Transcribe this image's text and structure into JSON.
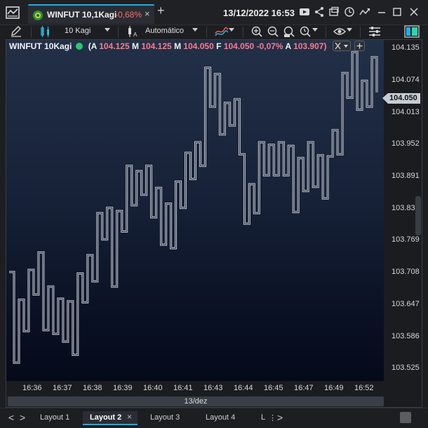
{
  "titlebar": {
    "tab_title": "WINFUT 10,1Kagi",
    "tab_change": "-0,68%",
    "close_glyph": "×",
    "new_tab_glyph": "+",
    "datetime": "13/12/2022 16:53"
  },
  "toolbar": {
    "period": "10 Kagi",
    "scale_mode": "Automático"
  },
  "legend": {
    "symbol": "WINFUT 10Kagi",
    "a_label": "(A",
    "a_value": "104.125",
    "m1_label": "M",
    "m1_value": "104.125",
    "m2_label": "M",
    "m2_value": "104.050",
    "f_label": "F",
    "f_value": "104.050",
    "change": "-0,07%",
    "a2_label": "A",
    "a2_value": "103.907)"
  },
  "chart_data": {
    "type": "line",
    "style": "kagi",
    "y_tick_labels": [
      "104.135",
      "104.074",
      "104.013",
      "103.952",
      "103.891",
      "103.83",
      "103.769",
      "103.708",
      "103.647",
      "103.586",
      "103.525"
    ],
    "x_tick_labels": [
      "16:36",
      "16:37",
      "16:38",
      "16:39",
      "16:40",
      "16:41",
      "16:43",
      "16:44",
      "16:45",
      "16:47",
      "16:49",
      "16:52"
    ],
    "date_label": "13/dez",
    "current_price": "104.050",
    "ylim": [
      103.5,
      104.15
    ],
    "line_color": "#c8ccd4",
    "kagi_path": [
      [
        0,
        103.708
      ],
      [
        1,
        103.708
      ],
      [
        1,
        103.535
      ],
      [
        2,
        103.535
      ],
      [
        2,
        103.655
      ],
      [
        3,
        103.655
      ],
      [
        3,
        103.595
      ],
      [
        4,
        103.595
      ],
      [
        4,
        103.712
      ],
      [
        5,
        103.712
      ],
      [
        5,
        103.665
      ],
      [
        6,
        103.665
      ],
      [
        6,
        103.745
      ],
      [
        7,
        103.745
      ],
      [
        7,
        103.597
      ],
      [
        8,
        103.597
      ],
      [
        8,
        103.68
      ],
      [
        9,
        103.68
      ],
      [
        9,
        103.59
      ],
      [
        10,
        103.59
      ],
      [
        10,
        103.657
      ],
      [
        11,
        103.657
      ],
      [
        11,
        103.575
      ],
      [
        12,
        103.575
      ],
      [
        12,
        103.652
      ],
      [
        13,
        103.652
      ],
      [
        13,
        103.55
      ],
      [
        14,
        103.55
      ],
      [
        14,
        103.705
      ],
      [
        15,
        103.705
      ],
      [
        15,
        103.65
      ],
      [
        16,
        103.65
      ],
      [
        16,
        103.74
      ],
      [
        17,
        103.74
      ],
      [
        17,
        103.69
      ],
      [
        18,
        103.69
      ],
      [
        18,
        103.82
      ],
      [
        19,
        103.82
      ],
      [
        19,
        103.77
      ],
      [
        20,
        103.77
      ],
      [
        20,
        103.83
      ],
      [
        21,
        103.83
      ],
      [
        21,
        103.68
      ],
      [
        22,
        103.68
      ],
      [
        22,
        103.824
      ],
      [
        23,
        103.824
      ],
      [
        23,
        103.785
      ],
      [
        24,
        103.785
      ],
      [
        24,
        103.91
      ],
      [
        25,
        103.91
      ],
      [
        25,
        103.835
      ],
      [
        26,
        103.835
      ],
      [
        26,
        103.9
      ],
      [
        27,
        103.9
      ],
      [
        27,
        103.855
      ],
      [
        28,
        103.855
      ],
      [
        28,
        103.91
      ],
      [
        29,
        103.91
      ],
      [
        29,
        103.812
      ],
      [
        30,
        103.812
      ],
      [
        30,
        103.868
      ],
      [
        31,
        103.868
      ],
      [
        31,
        103.76
      ],
      [
        32,
        103.76
      ],
      [
        32,
        103.838
      ],
      [
        33,
        103.838
      ],
      [
        33,
        103.753
      ],
      [
        34,
        103.753
      ],
      [
        34,
        103.88
      ],
      [
        35,
        103.88
      ],
      [
        35,
        103.83
      ],
      [
        36,
        103.83
      ],
      [
        36,
        103.935
      ],
      [
        37,
        103.935
      ],
      [
        37,
        103.885
      ],
      [
        38,
        103.885
      ],
      [
        38,
        103.955
      ],
      [
        39,
        103.955
      ],
      [
        39,
        103.91
      ],
      [
        40,
        103.91
      ],
      [
        40,
        104.097
      ],
      [
        41,
        104.097
      ],
      [
        41,
        104.023
      ],
      [
        42,
        104.023
      ],
      [
        42,
        104.085
      ],
      [
        43,
        104.085
      ],
      [
        43,
        103.97
      ],
      [
        44,
        103.97
      ],
      [
        44,
        104.03
      ],
      [
        45,
        104.03
      ],
      [
        45,
        103.987
      ],
      [
        46,
        103.987
      ],
      [
        46,
        104.037
      ],
      [
        47,
        104.037
      ],
      [
        47,
        103.932
      ],
      [
        48,
        103.932
      ],
      [
        48,
        103.8
      ],
      [
        49,
        103.8
      ],
      [
        49,
        103.875
      ],
      [
        50,
        103.875
      ],
      [
        50,
        103.82
      ],
      [
        51,
        103.82
      ],
      [
        51,
        103.955
      ],
      [
        52,
        103.955
      ],
      [
        52,
        103.892
      ],
      [
        53,
        103.892
      ],
      [
        53,
        103.95
      ],
      [
        54,
        103.95
      ],
      [
        54,
        103.892
      ],
      [
        55,
        103.892
      ],
      [
        55,
        103.955
      ],
      [
        56,
        103.955
      ],
      [
        56,
        103.892
      ],
      [
        57,
        103.892
      ],
      [
        57,
        103.948
      ],
      [
        58,
        103.948
      ],
      [
        58,
        103.822
      ],
      [
        59,
        103.822
      ],
      [
        59,
        103.925
      ],
      [
        60,
        103.925
      ],
      [
        60,
        103.862
      ],
      [
        61,
        103.862
      ],
      [
        61,
        103.955
      ],
      [
        62,
        103.955
      ],
      [
        62,
        103.87
      ],
      [
        63,
        103.87
      ],
      [
        63,
        103.93
      ],
      [
        64,
        103.93
      ],
      [
        64,
        103.848
      ],
      [
        65,
        103.848
      ],
      [
        65,
        103.928
      ],
      [
        66,
        103.928
      ],
      [
        66,
        103.978
      ],
      [
        67,
        103.978
      ],
      [
        67,
        103.932
      ],
      [
        68,
        103.932
      ],
      [
        68,
        104.087
      ],
      [
        69,
        104.087
      ],
      [
        69,
        104.04
      ],
      [
        70,
        104.04
      ],
      [
        70,
        104.127
      ],
      [
        71,
        104.127
      ],
      [
        71,
        104.017
      ],
      [
        72,
        104.017
      ],
      [
        72,
        104.072
      ],
      [
        73,
        104.072
      ],
      [
        73,
        104.023
      ],
      [
        74,
        104.023
      ],
      [
        74,
        104.117
      ],
      [
        75,
        104.117
      ],
      [
        75,
        104.05
      ]
    ]
  },
  "bottom": {
    "left_arrow": "<",
    "right_arrow": ">",
    "tabs": [
      "Layout 1",
      "Layout 2",
      "Layout 3",
      "Layout 4",
      "L"
    ],
    "close_glyph": "×",
    "more_glyph": "⋮"
  }
}
